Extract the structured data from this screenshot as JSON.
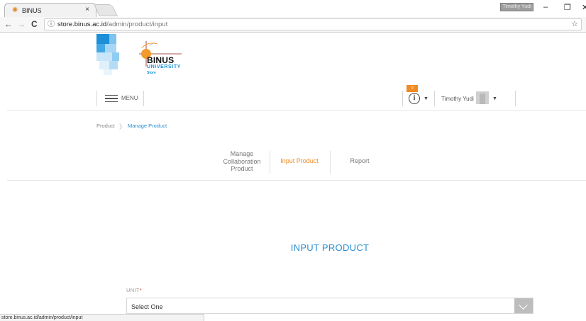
{
  "browser": {
    "tab_title": "BINUS",
    "tab_close": "×",
    "user_badge": "Timothy Yudi",
    "minimize": "–",
    "restore": "❐",
    "close": "✕",
    "back": "←",
    "forward": "→",
    "reload": "C",
    "url_host": "store.binus.ac.id",
    "url_path": "/admin/product/input",
    "status_url": "store.binus.ac.id/admin/product/input"
  },
  "logo": {
    "name": "BINUS",
    "sub": "UNIVERSITY",
    "store": "Store"
  },
  "topnav": {
    "menu_label": "MENU",
    "notification_count": "0",
    "info_glyph": "i",
    "user_name": "Timothy Yudi"
  },
  "breadcrumb": {
    "first": "Product",
    "separator": "〉",
    "current": "Manage Product"
  },
  "subtabs": {
    "manage_collab_line1": "Manage",
    "manage_collab_line2": "Collaboration",
    "manage_collab_line3": "Product",
    "input_product": "Input Product",
    "report": "Report"
  },
  "form": {
    "title": "INPUT PRODUCT",
    "unit_label": "UNIT",
    "required_mark": "*",
    "unit_value": "Select One"
  },
  "colors": {
    "accent_blue": "#2a8fd0",
    "accent_orange": "#f08a24"
  }
}
